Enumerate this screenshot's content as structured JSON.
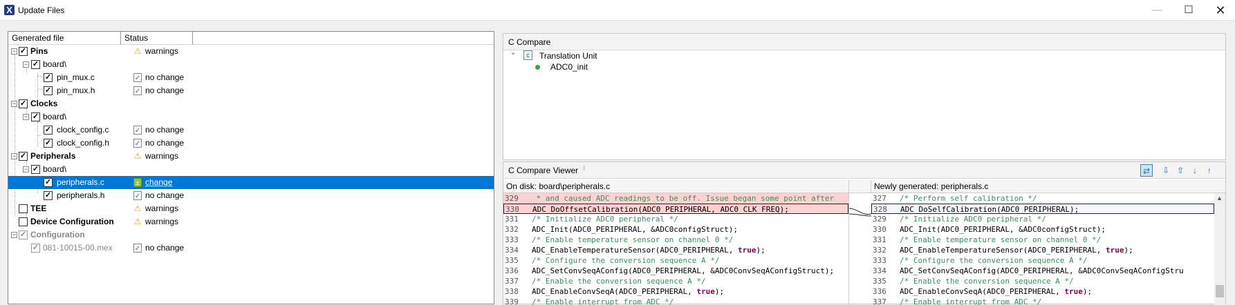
{
  "window": {
    "title": "Update Files",
    "minimize": "—",
    "maximize": "☐",
    "close": "✕"
  },
  "tree": {
    "headers": {
      "file": "Generated file",
      "status": "Status"
    },
    "rows": [
      {
        "label": "Pins",
        "status": "warnings"
      },
      {
        "label": "board\\",
        "status": ""
      },
      {
        "label": "pin_mux.c",
        "status": "no change"
      },
      {
        "label": "pin_mux.h",
        "status": "no change"
      },
      {
        "label": "Clocks",
        "status": ""
      },
      {
        "label": "board\\",
        "status": ""
      },
      {
        "label": "clock_config.c",
        "status": "no change"
      },
      {
        "label": "clock_config.h",
        "status": "no change"
      },
      {
        "label": "Peripherals",
        "status": "warnings"
      },
      {
        "label": "board\\",
        "status": ""
      },
      {
        "label": "peripherals.c",
        "status": "change"
      },
      {
        "label": "peripherals.h",
        "status": "no change"
      },
      {
        "label": "TEE",
        "status": "warnings"
      },
      {
        "label": "Device Configuration",
        "status": "warnings"
      },
      {
        "label": "Configuration",
        "status": ""
      },
      {
        "label": "081-10015-00.mex",
        "status": "no change"
      }
    ]
  },
  "c_compare": {
    "title": "C Compare",
    "unit": "Translation Unit",
    "function": "ADC0_init"
  },
  "viewer": {
    "title": "C Compare Viewer",
    "left_header": "On disk: board\\peripherals.c",
    "right_header": "Newly generated: peripherals.c",
    "left_lines": [
      {
        "n": "329",
        "t": " * and caused ADC readings to be off. Issue began some point after"
      },
      {
        "n": "330",
        "t": "ADC_DoOffsetCalibration(ADC0_PERIPHERAL, ADC0_CLK_FREQ);"
      },
      {
        "n": "331",
        "t": "/* Initialize ADC0 peripheral */"
      },
      {
        "n": "332",
        "t": "ADC_Init(ADC0_PERIPHERAL, &ADC0configStruct);"
      },
      {
        "n": "333",
        "t": "/* Enable temperature sensor on channel 0 */"
      },
      {
        "n": "334",
        "t": "ADC_EnableTemperatureSensor(ADC0_PERIPHERAL, "
      },
      {
        "n": "335",
        "t": "/* Configure the conversion sequence A */"
      },
      {
        "n": "336",
        "t": "ADC_SetConvSeqAConfig(ADC0_PERIPHERAL, &ADC0ConvSeqAConfigStruct);"
      },
      {
        "n": "337",
        "t": "/* Enable the conversion sequence A */"
      },
      {
        "n": "338",
        "t": "ADC_EnableConvSeqA(ADC0_PERIPHERAL, "
      },
      {
        "n": "339",
        "t": "/* Enable interrupt from ADC */"
      }
    ],
    "right_lines": [
      {
        "n": "327",
        "t": "/* Perform self calibration */"
      },
      {
        "n": "328",
        "t": "ADC_DoSelfCalibration(ADC0_PERIPHERAL);"
      },
      {
        "n": "329",
        "t": "/* Initialize ADC0 peripheral */"
      },
      {
        "n": "330",
        "t": "ADC_Init(ADC0_PERIPHERAL, &ADC0configStruct);"
      },
      {
        "n": "331",
        "t": "/* Enable temperature sensor on channel 0 */"
      },
      {
        "n": "332",
        "t": "ADC_EnableTemperatureSensor(ADC0_PERIPHERAL, "
      },
      {
        "n": "333",
        "t": "/* Configure the conversion sequence A */"
      },
      {
        "n": "334",
        "t": "ADC_SetConvSeqAConfig(ADC0_PERIPHERAL, &ADC0ConvSeqAConfigStru"
      },
      {
        "n": "335",
        "t": "/* Enable the conversion sequence A */"
      },
      {
        "n": "336",
        "t": "ADC_EnableConvSeqA(ADC0_PERIPHERAL, "
      },
      {
        "n": "337",
        "t": "/* Enable interrupt from ADC */"
      }
    ],
    "kw_true": "true",
    "kw_tail": ");"
  }
}
